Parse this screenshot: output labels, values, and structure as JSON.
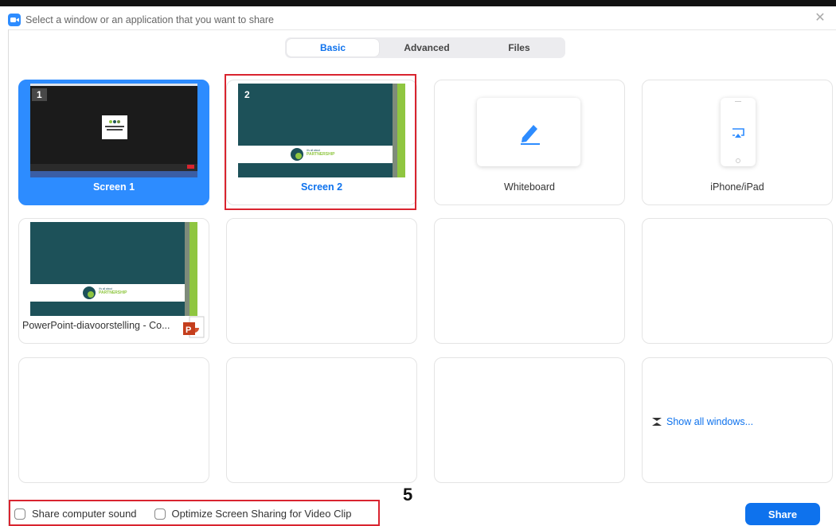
{
  "window": {
    "title": "Select a window or an application that you want to share"
  },
  "tabs": [
    {
      "label": "Basic",
      "active": true
    },
    {
      "label": "Advanced",
      "active": false
    },
    {
      "label": "Files",
      "active": false
    }
  ],
  "tiles": {
    "screen1": {
      "label": "Screen 1",
      "number": "1",
      "selected": true
    },
    "screen2": {
      "label": "Screen 2",
      "number": "2",
      "selected": false
    },
    "whiteboard": {
      "label": "Whiteboard"
    },
    "iphone": {
      "label": "iPhone/iPad"
    },
    "powerpoint": {
      "label": "PowerPoint-diavoorstelling  -  Co..."
    },
    "show_all": {
      "label": "Show all windows..."
    }
  },
  "thumbnails": {
    "screen1_logo_text": "CONGRESS BY DESIGN",
    "partnership_line1": "It's all about",
    "partnership_line2": "PARTNERSHIP"
  },
  "footer": {
    "share_sound": "Share computer sound",
    "optimize_video": "Optimize Screen Sharing for Video Clip",
    "share_button": "Share",
    "step_number": "5"
  },
  "colors": {
    "accent": "#2D8CFF",
    "button": "#0e72ed",
    "highlight": "#d9242f",
    "slide": "#1d5159",
    "slide_green": "#8fc640"
  },
  "icons": [
    "video-camera-icon",
    "close-icon",
    "pen-icon",
    "airplay-icon",
    "powerpoint-icon",
    "expand-icon"
  ]
}
